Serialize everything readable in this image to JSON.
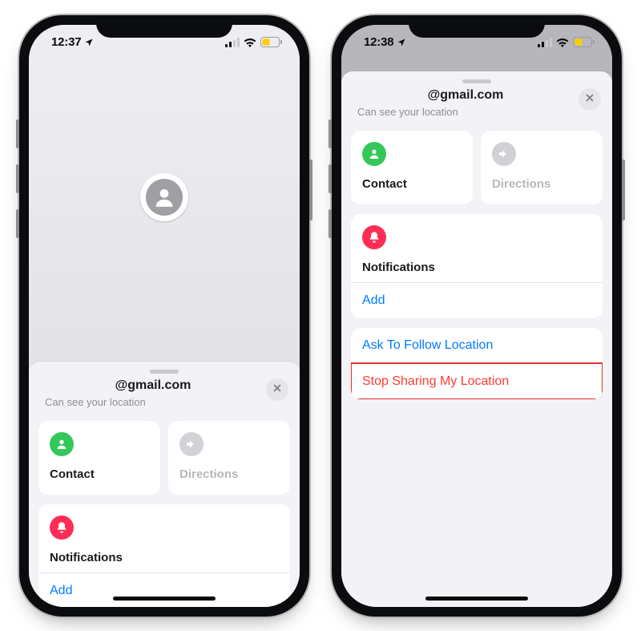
{
  "left": {
    "status": {
      "time": "12:37"
    },
    "sheet": {
      "title": "@gmail.com",
      "subtitle": "Can see your location",
      "tiles": {
        "contact": "Contact",
        "directions": "Directions"
      },
      "notifications_label": "Notifications",
      "add_label": "Add"
    }
  },
  "right": {
    "status": {
      "time": "12:38"
    },
    "sheet": {
      "title": "@gmail.com",
      "subtitle": "Can see your location",
      "tiles": {
        "contact": "Contact",
        "directions": "Directions"
      },
      "notifications_label": "Notifications",
      "add_label": "Add",
      "ask_follow_label": "Ask To Follow Location",
      "stop_sharing_label": "Stop Sharing My Location"
    }
  }
}
